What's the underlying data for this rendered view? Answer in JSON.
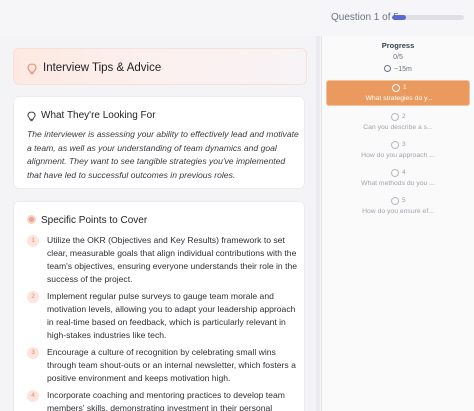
{
  "header": {
    "question_counter": "Question 1 of 5",
    "progress_fraction": 0.2
  },
  "tips": {
    "title": "Interview Tips & Advice",
    "looking_for": {
      "title": "What They're Looking For",
      "body": "The interviewer is assessing your ability to effectively lead and motivate a team, as well as your understanding of team dynamics and goal alignment. They want to see tangible strategies you've implemented that have led to successful outcomes in previous roles."
    },
    "points": {
      "title": "Specific Points to Cover",
      "items": [
        {
          "num": "1",
          "text": "Utilize the OKR (Objectives and Key Results) framework to set clear, measurable goals that align individual contributions with the team's objectives, ensuring everyone understands their role in the success of the project."
        },
        {
          "num": "2",
          "text": "Implement regular pulse surveys to gauge team morale and motivation levels, allowing you to adapt your leadership approach in real-time based on feedback, which is particularly relevant in high-stakes industries like tech."
        },
        {
          "num": "3",
          "text": "Encourage a culture of recognition by celebrating small wins through team shout-outs or an internal newsletter, which fosters a positive environment and keeps motivation high."
        },
        {
          "num": "4",
          "text": "Incorporate coaching and mentoring practices to develop team members' skills, demonstrating investment in their personal growth,"
        }
      ]
    }
  },
  "sidebar": {
    "title": "Progress",
    "count": "0/5",
    "time": "~15m",
    "questions": [
      {
        "num": "1",
        "label": "What strategies do y...",
        "active": true
      },
      {
        "num": "2",
        "label": "Can you describe a s...",
        "active": false
      },
      {
        "num": "3",
        "label": "How do you approach ...",
        "active": false
      },
      {
        "num": "4",
        "label": "What methods do you ...",
        "active": false
      },
      {
        "num": "5",
        "label": "How do you ensure ef...",
        "active": false
      }
    ]
  },
  "colors": {
    "accent_orange": "#ea9a5e",
    "progress_blue": "#5b6ad0",
    "point_badge": "#fde4dc"
  }
}
